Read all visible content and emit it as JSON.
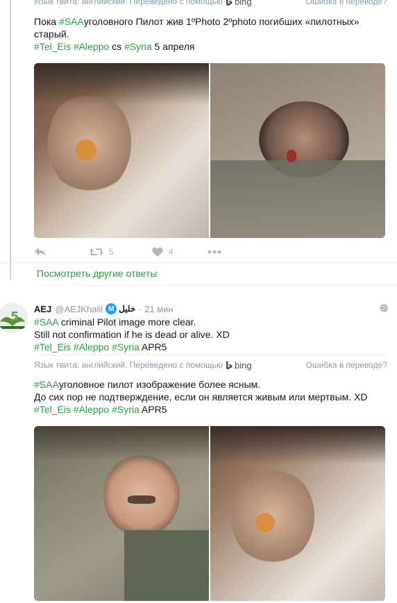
{
  "translate": {
    "prefix": "Язык твита: английский. Переведено с помощью",
    "bing": "bing",
    "error": "Ошибка в переводе?"
  },
  "tweet1": {
    "lines": [
      [
        {
          "t": "Пока "
        },
        {
          "t": "#SAA",
          "tag": true
        },
        {
          "t": "уголовного Пилот жив 1ºPhoto 2ºphoto погибших «пилотных»"
        }
      ],
      [
        {
          "t": "старый."
        }
      ],
      [
        {
          "t": "#Tel_Eis",
          "tag": true
        },
        {
          "t": " "
        },
        {
          "t": "#Aleppo",
          "tag": true
        },
        {
          "t": " cs "
        },
        {
          "t": "#Syria",
          "tag": true
        },
        {
          "t": " 5 апреля"
        }
      ]
    ],
    "retweet_count": "5",
    "like_count": "4"
  },
  "more_replies": "Посмотреть другие ответы",
  "tweet2": {
    "name": "AEJ",
    "handle": "@AEJKhalil",
    "badge": "M",
    "arabic": "خليل",
    "time": "· 21 мин",
    "original_lines": [
      [
        {
          "t": "#SAA",
          "tag": true
        },
        {
          "t": " criminal Pilot image more clear."
        }
      ],
      [
        {
          "t": "Still not confirmation if he is dead or alive. XD"
        }
      ],
      [
        {
          "t": "#Tel_Eis",
          "tag": true
        },
        {
          "t": " "
        },
        {
          "t": "#Aleppo",
          "tag": true
        },
        {
          "t": " "
        },
        {
          "t": "#Syria",
          "tag": true
        },
        {
          "t": " APR5"
        }
      ]
    ],
    "translated_lines": [
      [
        {
          "t": "#SAA",
          "tag": true
        },
        {
          "t": "уголовное пилот изображение более ясным."
        }
      ],
      [
        {
          "t": "До сих пор не подтверждение, если он является живым или мертвым. XD"
        }
      ],
      [
        {
          "t": "#Tel_Eis",
          "tag": true
        },
        {
          "t": " "
        },
        {
          "t": "#Aleppo",
          "tag": true
        },
        {
          "t": " "
        },
        {
          "t": "#Syria",
          "tag": true
        },
        {
          "t": " APR5"
        }
      ]
    ]
  },
  "colors": {
    "hashtag": "#2a9d3c",
    "meta": "#8899a6",
    "icon": "#aab8c2"
  }
}
